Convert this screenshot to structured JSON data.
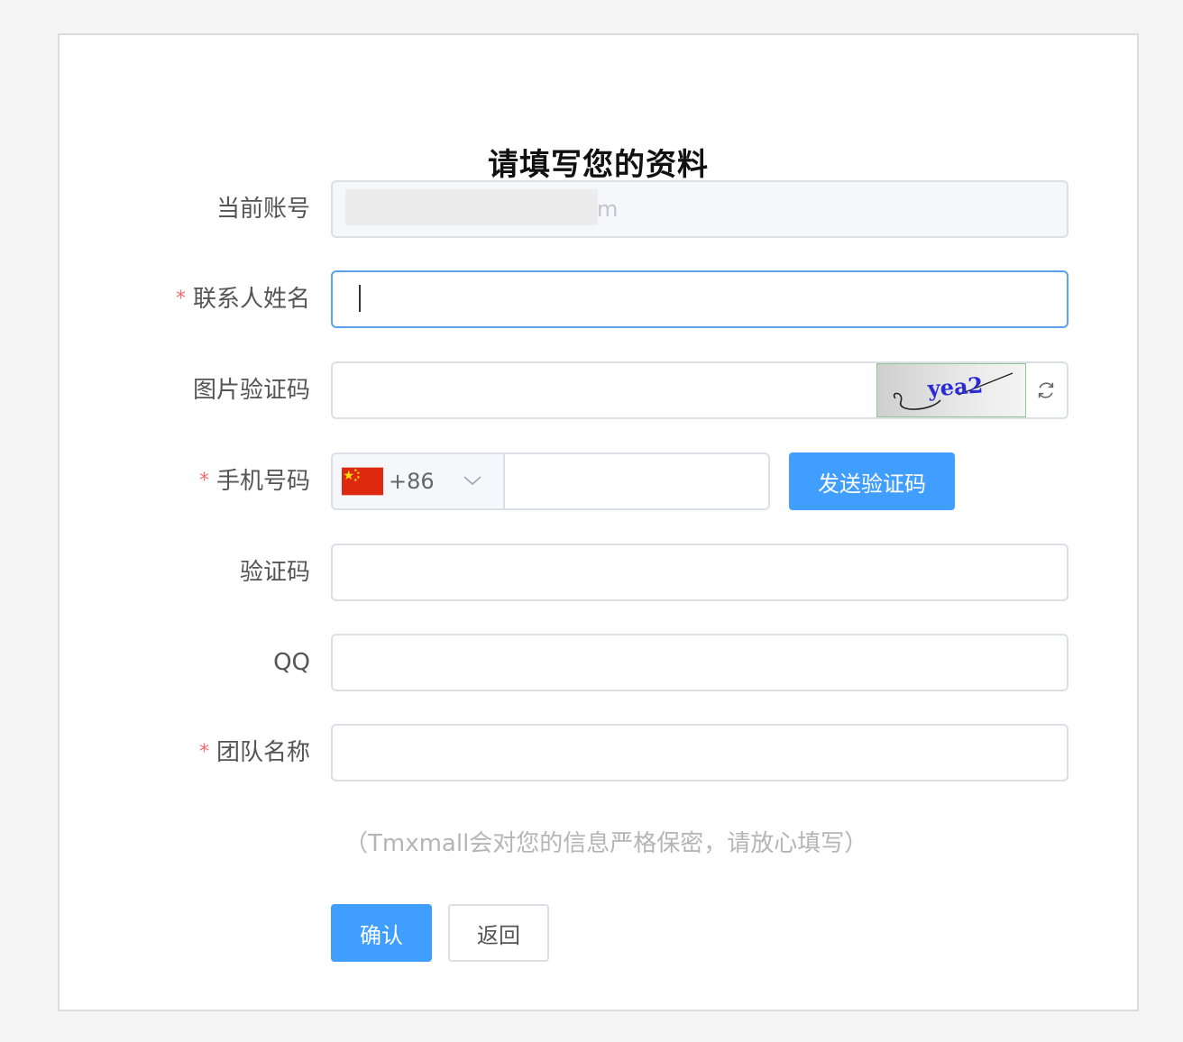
{
  "form": {
    "title": "请填写您的资料",
    "account": {
      "label": "当前账号",
      "value_visible_suffix": "m"
    },
    "contact_name": {
      "label": "联系人姓名",
      "required": true,
      "value": ""
    },
    "image_captcha": {
      "label": "图片验证码",
      "value": "",
      "captcha_text": "yea2",
      "refresh_icon": "refresh-icon"
    },
    "phone": {
      "label": "手机号码",
      "required": true,
      "country_flag": "cn-flag-icon",
      "dial_code": "+86",
      "value": "",
      "send_code_label": "发送验证码"
    },
    "sms_code": {
      "label": "验证码",
      "value": ""
    },
    "qq": {
      "label": "QQ",
      "value": ""
    },
    "team_name": {
      "label": "团队名称",
      "required": true,
      "value": ""
    },
    "notice": "（Tmxmall会对您的信息严格保密，请放心填写）",
    "confirm_label": "确认",
    "back_label": "返回",
    "required_mark": "*"
  },
  "colors": {
    "primary": "#409eff",
    "required": "#f56c6c",
    "focus_border": "#5aa5ea",
    "border": "#dcdfe6",
    "captcha_text": "#2b2bd6"
  }
}
